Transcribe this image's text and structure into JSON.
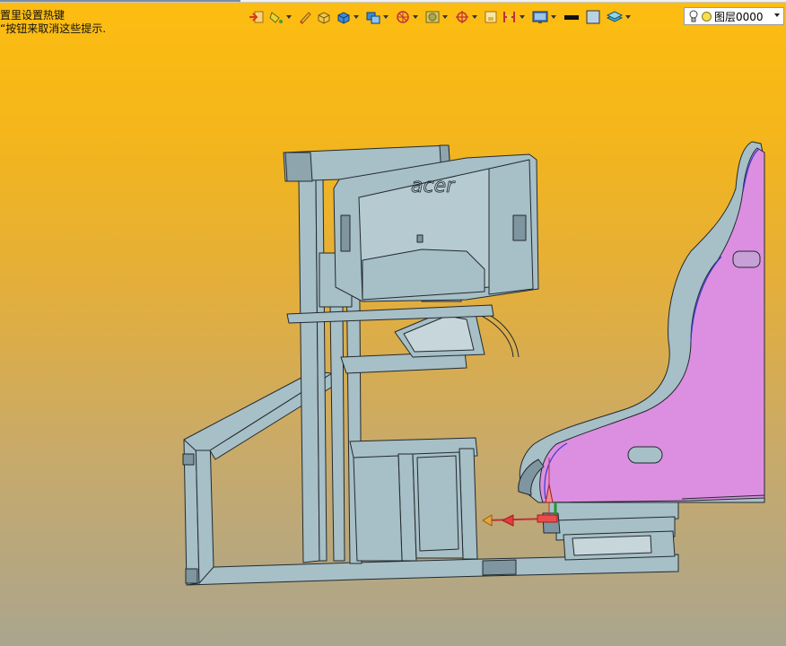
{
  "hint": {
    "line1": "置里设置热键",
    "line2": "“按钮来取消这些提示."
  },
  "toolbar": {
    "items": [
      {
        "icon": "import-arrow-icon",
        "dropdown": false
      },
      {
        "icon": "paint-bucket-icon",
        "dropdown": true
      },
      {
        "icon": "pencil-icon",
        "dropdown": false
      },
      {
        "icon": "box-solid-icon",
        "dropdown": false
      },
      {
        "icon": "box-blue-icon",
        "dropdown": true
      },
      {
        "icon": "multi-box-icon",
        "dropdown": true
      },
      {
        "icon": "wheel-view-icon",
        "dropdown": true
      },
      {
        "icon": "shaded-view-icon",
        "dropdown": true
      },
      {
        "icon": "snap-target-icon",
        "dropdown": true
      },
      {
        "icon": "frame-icon",
        "dropdown": false
      },
      {
        "icon": "section-icon",
        "dropdown": true
      },
      {
        "icon": "display-mode-icon",
        "dropdown": true
      },
      {
        "icon": "line-color-icon",
        "dropdown": false
      },
      {
        "icon": "fill-color-icon",
        "dropdown": false
      },
      {
        "icon": "layers-icon",
        "dropdown": true
      }
    ]
  },
  "layer": {
    "value": "图层0000"
  },
  "colors": {
    "model_fill": "#a7bfc6",
    "model_stroke": "#222a30",
    "seat_fill": "#dc8fe0",
    "background_top": "#fdbd11",
    "background_bottom": "#aaa58e"
  }
}
